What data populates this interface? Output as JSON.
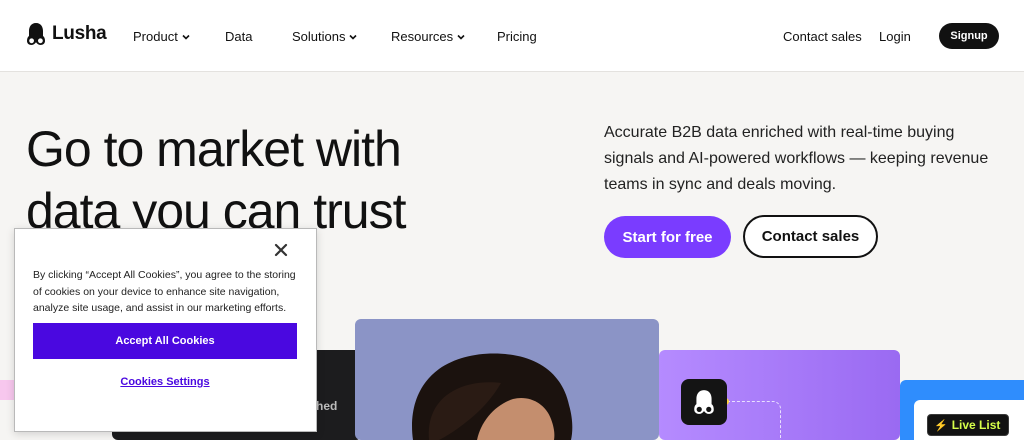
{
  "nav": {
    "brand": "Lusha",
    "items": [
      {
        "label": "Product",
        "has_dropdown": true
      },
      {
        "label": "Data",
        "has_dropdown": false
      },
      {
        "label": "Solutions",
        "has_dropdown": true
      },
      {
        "label": "Resources",
        "has_dropdown": true
      },
      {
        "label": "Pricing",
        "has_dropdown": false
      }
    ],
    "contact_sales": "Contact sales",
    "login": "Login",
    "signup": "Signup"
  },
  "hero": {
    "title_line1": "Go to market with",
    "title_line2": "data you can trust",
    "description": "Accurate B2B data enriched with real-time buying signals and AI-powered workflows — keeping revenue teams in sync and deals moving.",
    "primary_cta": "Start for free",
    "secondary_cta": "Contact sales"
  },
  "visuals": {
    "dark_card_text": "hed",
    "live_badge": "Live List",
    "icons": [
      "lusha-logo-icon",
      "bolt-icon",
      "chevron-down-icon",
      "close-icon"
    ]
  },
  "cookie_banner": {
    "text": "By clicking “Accept All Cookies”, you agree to the storing of cookies on your device to enhance site navigation, analyze site usage, and assist in our marketing efforts.",
    "accept": "Accept All Cookies",
    "settings": "Cookies Settings"
  },
  "colors": {
    "accent_purple": "#7a3cff",
    "cookie_purple": "#4a08e0",
    "dark": "#111111",
    "live_green": "#d6ff4a"
  }
}
